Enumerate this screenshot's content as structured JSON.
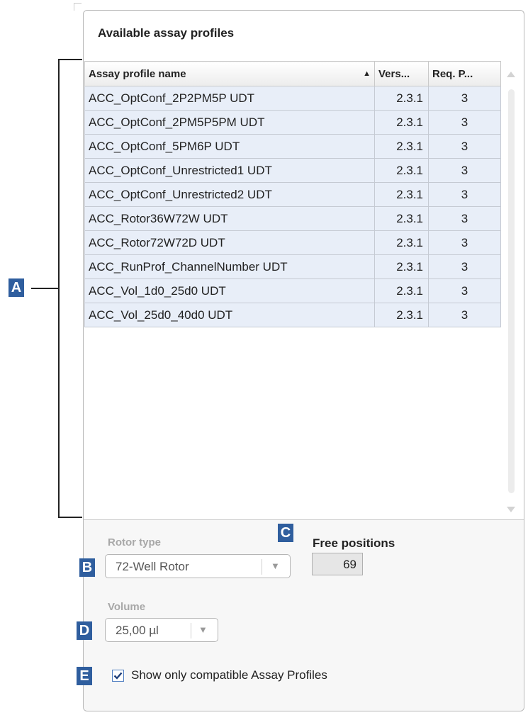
{
  "panel": {
    "title": "Available assay profiles"
  },
  "table": {
    "columns": [
      "Assay profile name",
      "Vers...",
      "Req. P..."
    ],
    "sort_column": "Assay profile name",
    "sort_direction": "ascending",
    "rows": [
      {
        "name": "ACC_OptConf_2P2PM5P UDT",
        "version": "2.3.1",
        "req": "3"
      },
      {
        "name": "ACC_OptConf_2PM5P5PM UDT",
        "version": "2.3.1",
        "req": "3"
      },
      {
        "name": "ACC_OptConf_5PM6P UDT",
        "version": "2.3.1",
        "req": "3"
      },
      {
        "name": "ACC_OptConf_Unrestricted1 UDT",
        "version": "2.3.1",
        "req": "3"
      },
      {
        "name": "ACC_OptConf_Unrestricted2 UDT",
        "version": "2.3.1",
        "req": "3"
      },
      {
        "name": "ACC_Rotor36W72W UDT",
        "version": "2.3.1",
        "req": "3"
      },
      {
        "name": "ACC_Rotor72W72D UDT",
        "version": "2.3.1",
        "req": "3"
      },
      {
        "name": "ACC_RunProf_ChannelNumber UDT",
        "version": "2.3.1",
        "req": "3"
      },
      {
        "name": "ACC_Vol_1d0_25d0 UDT",
        "version": "2.3.1",
        "req": "3"
      },
      {
        "name": "ACC_Vol_25d0_40d0 UDT",
        "version": "2.3.1",
        "req": "3"
      }
    ]
  },
  "rotor": {
    "label": "Rotor type",
    "value": "72-Well Rotor"
  },
  "free_positions": {
    "label": "Free positions",
    "value": "69"
  },
  "volume": {
    "label": "Volume",
    "value": "25,00 µl"
  },
  "compatible_filter": {
    "label": "Show only compatible Assay Profiles",
    "checked": true
  },
  "callouts": {
    "a": "A",
    "b": "B",
    "c": "C",
    "d": "D",
    "e": "E"
  },
  "colors": {
    "callout": "#2f5e9e",
    "row_background": "#e8eef8",
    "checkbox": "#2f5e9e"
  }
}
